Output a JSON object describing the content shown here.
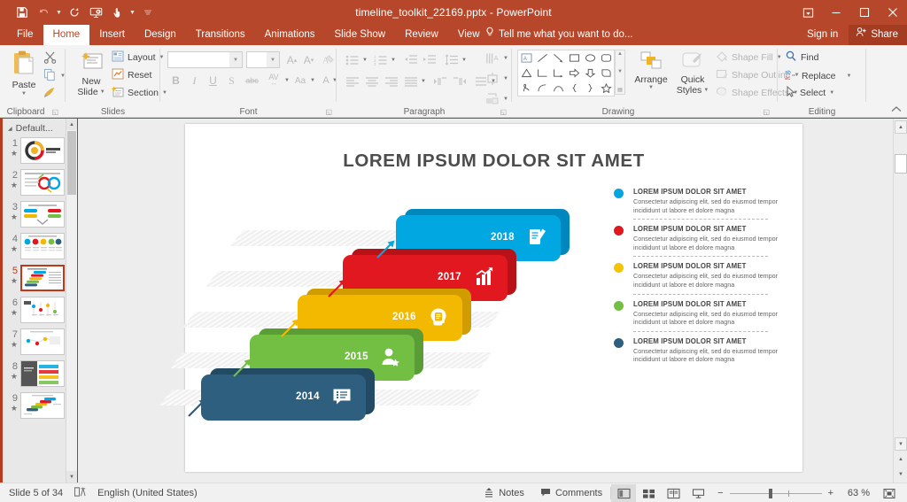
{
  "window": {
    "title": "timeline_toolkit_22169.pptx - PowerPoint",
    "qat": [
      {
        "name": "save-icon",
        "label": "Save"
      },
      {
        "name": "undo-icon",
        "label": "Undo"
      },
      {
        "name": "redo-icon",
        "label": "Redo"
      },
      {
        "name": "start-presentation-icon",
        "label": "Start From Beginning"
      },
      {
        "name": "touch-mode-icon",
        "label": "Touch/Mouse Mode"
      },
      {
        "name": "customize-quick-access-toolbar-icon",
        "label": "Customize Quick Access Toolbar"
      }
    ],
    "controls": [
      {
        "name": "ribbon-display-options-button",
        "glyph": "⬒"
      },
      {
        "name": "minimize-button",
        "glyph": "─"
      },
      {
        "name": "maximize-button",
        "glyph": "☐"
      },
      {
        "name": "close-button",
        "glyph": "✕"
      }
    ]
  },
  "ribbon": {
    "tabs": [
      {
        "label": "File",
        "active": false
      },
      {
        "label": "Home",
        "active": true
      },
      {
        "label": "Insert",
        "active": false
      },
      {
        "label": "Design",
        "active": false
      },
      {
        "label": "Transitions",
        "active": false
      },
      {
        "label": "Animations",
        "active": false
      },
      {
        "label": "Slide Show",
        "active": false
      },
      {
        "label": "Review",
        "active": false
      },
      {
        "label": "View",
        "active": false
      }
    ],
    "tell_me": "Tell me what you want to do...",
    "sign_in": "Sign in",
    "share": "Share",
    "groups": {
      "clipboard": {
        "label": "Clipboard",
        "paste": "Paste",
        "cut": "Cut",
        "copy": "Copy",
        "format_painter": "Format Painter"
      },
      "slides": {
        "label": "Slides",
        "new_slide": "New\nSlide",
        "new_slide_line1": "New",
        "new_slide_line2": "Slide",
        "layout": "Layout",
        "reset": "Reset",
        "section": "Section"
      },
      "font": {
        "label": "Font",
        "font_name_value": "",
        "font_size_value": "",
        "bold": "B",
        "italic": "I",
        "underline": "U",
        "shadow": "S",
        "strikethrough": "abc",
        "character_spacing": "AV",
        "change_case": "Aa",
        "font_color": "A"
      },
      "paragraph": {
        "label": "Paragraph"
      },
      "drawing": {
        "label": "Drawing",
        "arrange": "Arrange",
        "quick_styles_line1": "Quick",
        "quick_styles_line2": "Styles",
        "shape_fill": "Shape Fill",
        "shape_outline": "Shape Outline",
        "shape_effects": "Shape Effects"
      },
      "editing": {
        "label": "Editing",
        "find": "Find",
        "replace": "Replace",
        "select": "Select"
      }
    },
    "collapse_label": "Collapse the Ribbon"
  },
  "slide_panel": {
    "section_name": "Default...",
    "thumbnails": [
      {
        "number": "1",
        "selected": false
      },
      {
        "number": "2",
        "selected": false
      },
      {
        "number": "3",
        "selected": false
      },
      {
        "number": "4",
        "selected": false
      },
      {
        "number": "5",
        "selected": true
      },
      {
        "number": "6",
        "selected": false
      },
      {
        "number": "7",
        "selected": false
      },
      {
        "number": "8",
        "selected": false
      },
      {
        "number": "9",
        "selected": false
      }
    ]
  },
  "slide": {
    "title": "LOREM IPSUM DOLOR SIT AMET",
    "timeline": [
      {
        "year": "2018",
        "color": "#00a7e1",
        "shadow": "#0087bd",
        "icon": "document-pen-icon"
      },
      {
        "year": "2017",
        "color": "#e1181f",
        "shadow": "#b61218",
        "icon": "bar-chart-growth-icon"
      },
      {
        "year": "2016",
        "color": "#f3b800",
        "shadow": "#d09c00",
        "icon": "head-idea-icon"
      },
      {
        "year": "2015",
        "color": "#72bf44",
        "shadow": "#5a9c35",
        "icon": "user-star-icon"
      },
      {
        "year": "2014",
        "color": "#2e5f7e",
        "shadow": "#234a63",
        "icon": "chat-list-icon"
      }
    ],
    "legend": [
      {
        "color": "#00a7e1",
        "title": "LOREM IPSUM DOLOR SIT AMET",
        "body": "Consectetur adipiscing elit, sed do eiusmod tempor incididunt ut labore et dolore magna"
      },
      {
        "color": "#e1181f",
        "title": "LOREM IPSUM DOLOR SIT AMET",
        "body": "Consectetur adipiscing elit, sed do eiusmod tempor incididunt ut labore et dolore magna"
      },
      {
        "color": "#f3c400",
        "title": "LOREM IPSUM DOLOR SIT AMET",
        "body": "Consectetur adipiscing elit, sed do eiusmod tempor incididunt ut labore et dolore magna"
      },
      {
        "color": "#72bf44",
        "title": "LOREM IPSUM DOLOR SIT AMET",
        "body": "Consectetur adipiscing elit, sed do eiusmod tempor incididunt ut labore et dolore magna"
      },
      {
        "color": "#2e5f7e",
        "title": "LOREM IPSUM DOLOR SIT AMET",
        "body": "Consectetur adipiscing elit, sed do eiusmod tempor incididunt ut labore et dolore magna"
      }
    ]
  },
  "status_bar": {
    "slide_counter": "Slide 5 of 34",
    "language": "English (United States)",
    "notes": "Notes",
    "comments": "Comments",
    "zoom_percent": "63 %",
    "views": [
      {
        "name": "normal-view-button",
        "active": true
      },
      {
        "name": "slide-sorter-view-button",
        "active": false
      },
      {
        "name": "reading-view-button",
        "active": false
      },
      {
        "name": "slide-show-button",
        "active": false
      }
    ],
    "zoom_out": "−",
    "zoom_in": "+",
    "fit_slide": "Fit slide to current window"
  }
}
